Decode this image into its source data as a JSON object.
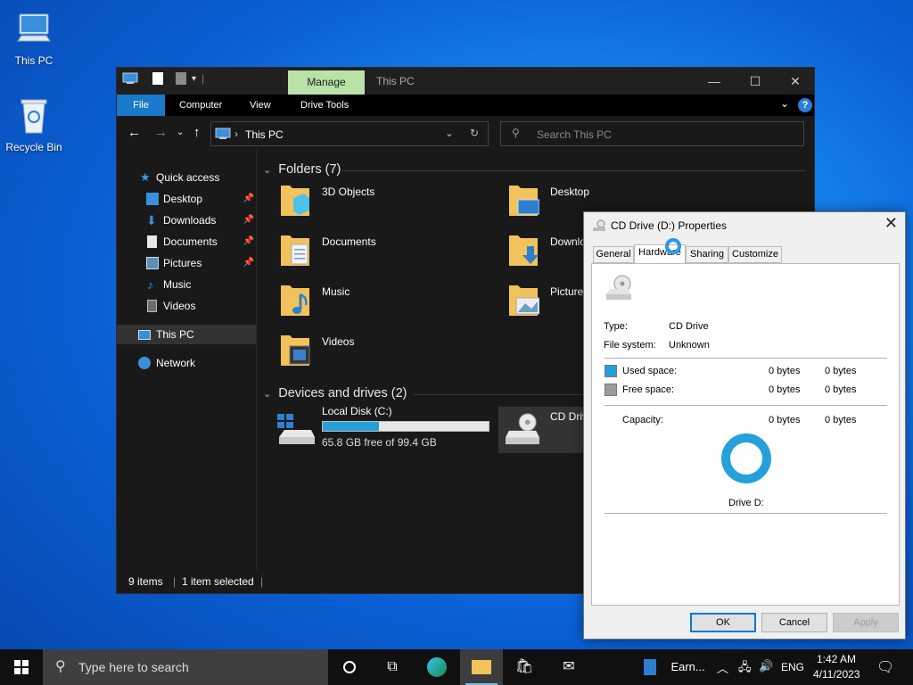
{
  "desktop": {
    "icons": [
      {
        "label": "This PC",
        "icon": "computer-icon"
      },
      {
        "label": "Recycle Bin",
        "icon": "recycle-bin-icon"
      }
    ]
  },
  "explorer": {
    "title": "This PC",
    "manage_tab": "Manage",
    "ribbon_tabs": [
      "File",
      "Computer",
      "View",
      "Drive Tools"
    ],
    "address": "This PC",
    "search_placeholder": "Search This PC",
    "nav": {
      "quick_access": "Quick access",
      "pinned": [
        "Desktop",
        "Downloads",
        "Documents",
        "Pictures"
      ],
      "other": [
        "Music",
        "Videos"
      ],
      "this_pc": "This PC",
      "network": "Network"
    },
    "folders_header": "Folders (7)",
    "folders": [
      "3D Objects",
      "Desktop",
      "Documents",
      "Downlo",
      "Music",
      "Pictures",
      "Videos"
    ],
    "devices_header": "Devices and drives (2)",
    "drives": [
      {
        "name": "Local Disk (C:)",
        "free_text": "65.8 GB free of 99.4 GB",
        "used_fraction": 0.34
      },
      {
        "name": "CD Driv"
      }
    ],
    "status": {
      "items": "9 items",
      "selected": "1 item selected"
    }
  },
  "dialog": {
    "title": "CD Drive (D:) Properties",
    "tabs": [
      "General",
      "Hardware",
      "Sharing",
      "Customize"
    ],
    "active_tab": "Hardware",
    "type_label": "Type:",
    "type_value": "CD Drive",
    "fs_label": "File system:",
    "fs_value": "Unknown",
    "used_label": "Used space:",
    "used_bytes": "0 bytes",
    "used_bytes2": "0 bytes",
    "free_label": "Free space:",
    "free_bytes": "0 bytes",
    "free_bytes2": "0 bytes",
    "capacity_label": "Capacity:",
    "capacity_bytes": "0 bytes",
    "capacity_bytes2": "0 bytes",
    "drive_label": "Drive D:",
    "buttons": {
      "ok": "OK",
      "cancel": "Cancel",
      "apply": "Apply"
    },
    "colors": {
      "used": "#26a0da",
      "free": "#9b9b9b"
    }
  },
  "taskbar": {
    "search_placeholder": "Type here to search",
    "app_label": "Earn...",
    "lang": "ENG",
    "time": "1:42 AM",
    "date": "4/11/2023"
  }
}
